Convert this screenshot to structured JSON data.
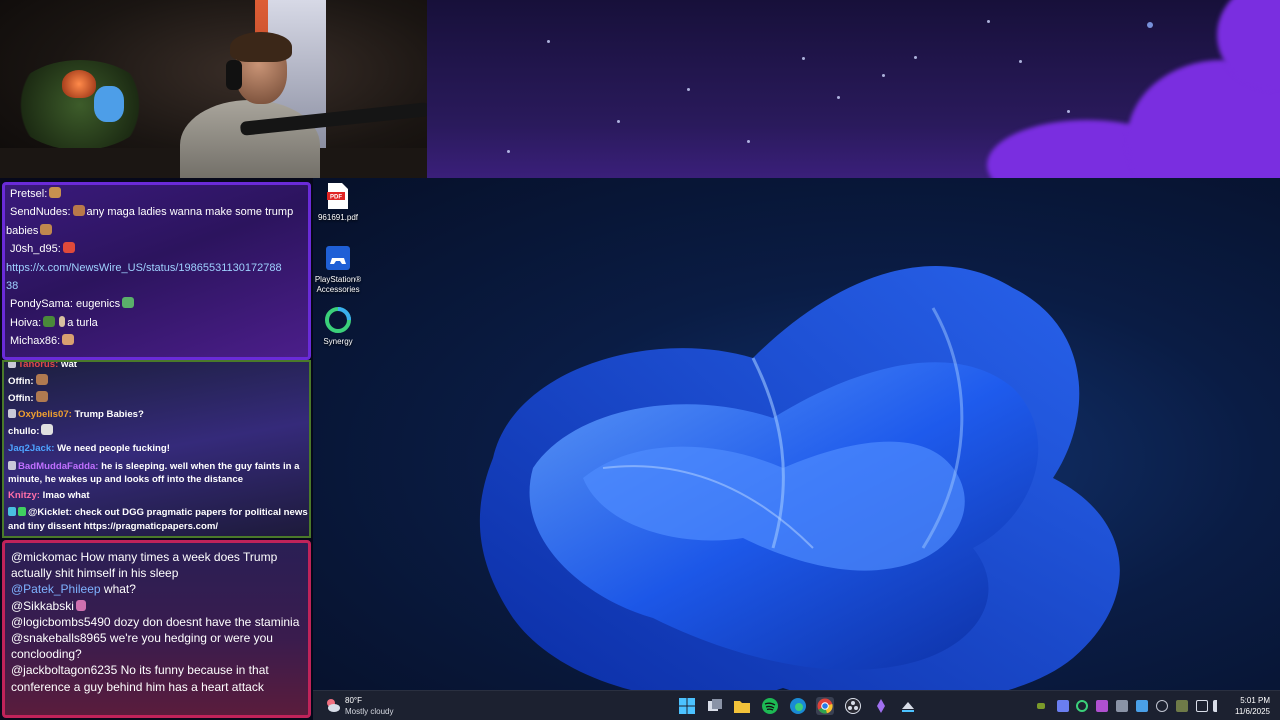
{
  "desktop_icons": [
    {
      "label": "961691.pdf",
      "icon": "pdf-file-icon"
    },
    {
      "label": "PlayStation® Accessories",
      "icon": "playstation-icon"
    },
    {
      "label": "Synergy",
      "icon": "synergy-icon"
    }
  ],
  "chat_top": [
    {
      "user": "Pretsel:",
      "text": ""
    },
    {
      "user": "SendNudes:",
      "text": "any maga ladies wanna make some trump"
    },
    {
      "user": "",
      "text": "babies"
    },
    {
      "user": "J0sh_d95:",
      "text": ""
    },
    {
      "user": "",
      "link": "https://x.com/NewsWire_US/status/19865531130172788"
    },
    {
      "user": "",
      "link": "38"
    },
    {
      "user": "PondySama:",
      "text": "eugenics"
    },
    {
      "user": "Hoiva:",
      "text": "a turla"
    },
    {
      "user": "Michax86:",
      "text": ""
    }
  ],
  "chat_mid": [
    {
      "user": "Tanorus:",
      "color": "#e04a4a",
      "text": "wat"
    },
    {
      "user": "Offin:",
      "color": "#ffffff",
      "text": ""
    },
    {
      "user": "Offin:",
      "color": "#ffffff",
      "text": ""
    },
    {
      "user": "Oxybelis07:",
      "color": "#f0a030",
      "text": "Trump Babies?"
    },
    {
      "user": "chullo:",
      "color": "#ffffff",
      "text": ""
    },
    {
      "user": "Jaq2Jack:",
      "color": "#4da3ff",
      "text": "We need people fucking!"
    },
    {
      "user": "BadMuddaFadda:",
      "color": "#c070ff",
      "text": "he is sleeping. well when the guy faints in a minute, he wakes up and looks off into the distance"
    },
    {
      "user": "Knitzy:",
      "color": "#ff6fa8",
      "text": "lmao what"
    },
    {
      "user": "@Kicklet:",
      "color": "#ffffff",
      "text": "check out DGG pragmatic papers for political news and tiny dissent https://pragmaticpapers.com/"
    }
  ],
  "chat_bottom": [
    {
      "user": "@mickomac",
      "blue": false,
      "text": "How many times a week does Trump actually shit himself in his sleep"
    },
    {
      "user": "@Patek_Phileep",
      "blue": true,
      "text": "what?"
    },
    {
      "user": "@Sikkabski",
      "blue": false,
      "text": ""
    },
    {
      "user": "@logicbombs5490",
      "blue": false,
      "text": "dozy don doesnt have the staminia"
    },
    {
      "user": "@snakeballs8965",
      "blue": false,
      "text": "we're you hedging or were you conclooding?"
    },
    {
      "user": "@jackboltagon6235",
      "blue": false,
      "text": "No its funny because in that conference a guy behind him has a heart attack"
    }
  ],
  "taskbar": {
    "weather_temp": "80°F",
    "weather_desc": "Mostly cloudy",
    "time": "5:01 PM",
    "date": "11/6/2025",
    "apps": [
      "windows-start-icon",
      "task-view-icon",
      "file-explorer-icon",
      "spotify-icon",
      "edge-icon",
      "chrome-icon",
      "obs-icon",
      "app-icon",
      "steam-icon"
    ]
  }
}
